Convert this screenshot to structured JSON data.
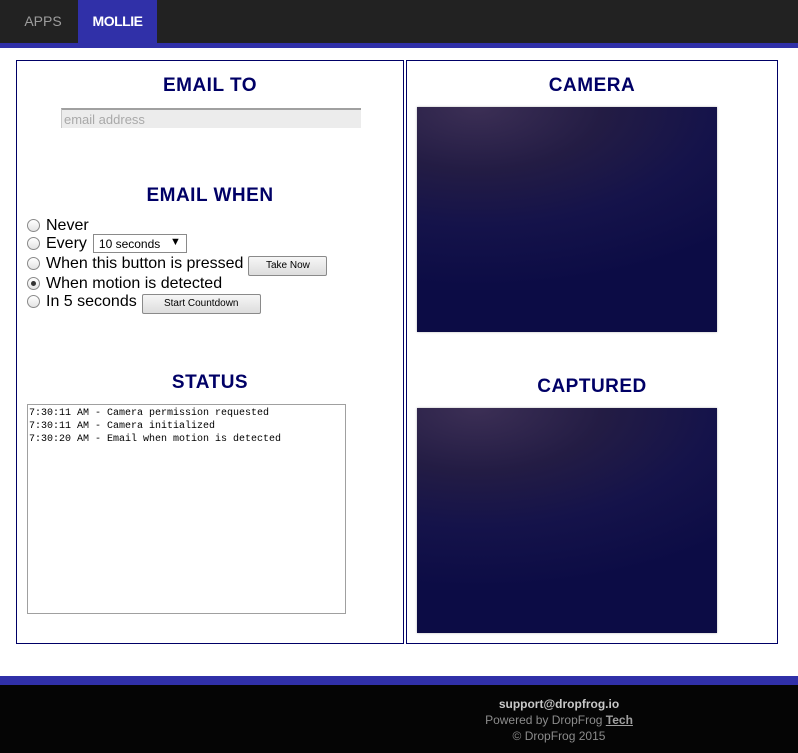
{
  "nav": {
    "tabs": [
      {
        "label": "APPS"
      },
      {
        "label": "MOLLIE"
      }
    ],
    "active": "MOLLIE"
  },
  "email_to": {
    "heading": "EMAIL TO",
    "placeholder": "email address",
    "value": ""
  },
  "email_when": {
    "heading": "EMAIL WHEN",
    "options": [
      {
        "label": "Never",
        "checked": false
      },
      {
        "label": "Every",
        "checked": false
      },
      {
        "label": "When this button is pressed",
        "checked": false
      },
      {
        "label": "When motion is detected",
        "checked": true
      },
      {
        "label": "In 5 seconds",
        "checked": false
      }
    ],
    "interval_select": {
      "selected": "10 seconds",
      "arrow": "▼"
    },
    "take_now_label": "Take Now",
    "countdown_label": "Start Countdown"
  },
  "status": {
    "heading": "STATUS",
    "lines": [
      "7:30:11 AM - Camera permission requested",
      "7:30:11 AM - Camera initialized",
      "7:30:20 AM - Email when motion is detected"
    ]
  },
  "camera": {
    "heading": "CAMERA"
  },
  "captured": {
    "heading": "CAPTURED"
  },
  "footer": {
    "email": "support@dropfrog.io",
    "powered_prefix": "Powered by DropFrog ",
    "powered_link": "Tech",
    "copyright": "© DropFrog 2015"
  },
  "colors": {
    "accent": "#3030a8",
    "heading": "#000066",
    "navbar": "#222222",
    "footer": "#050505"
  }
}
